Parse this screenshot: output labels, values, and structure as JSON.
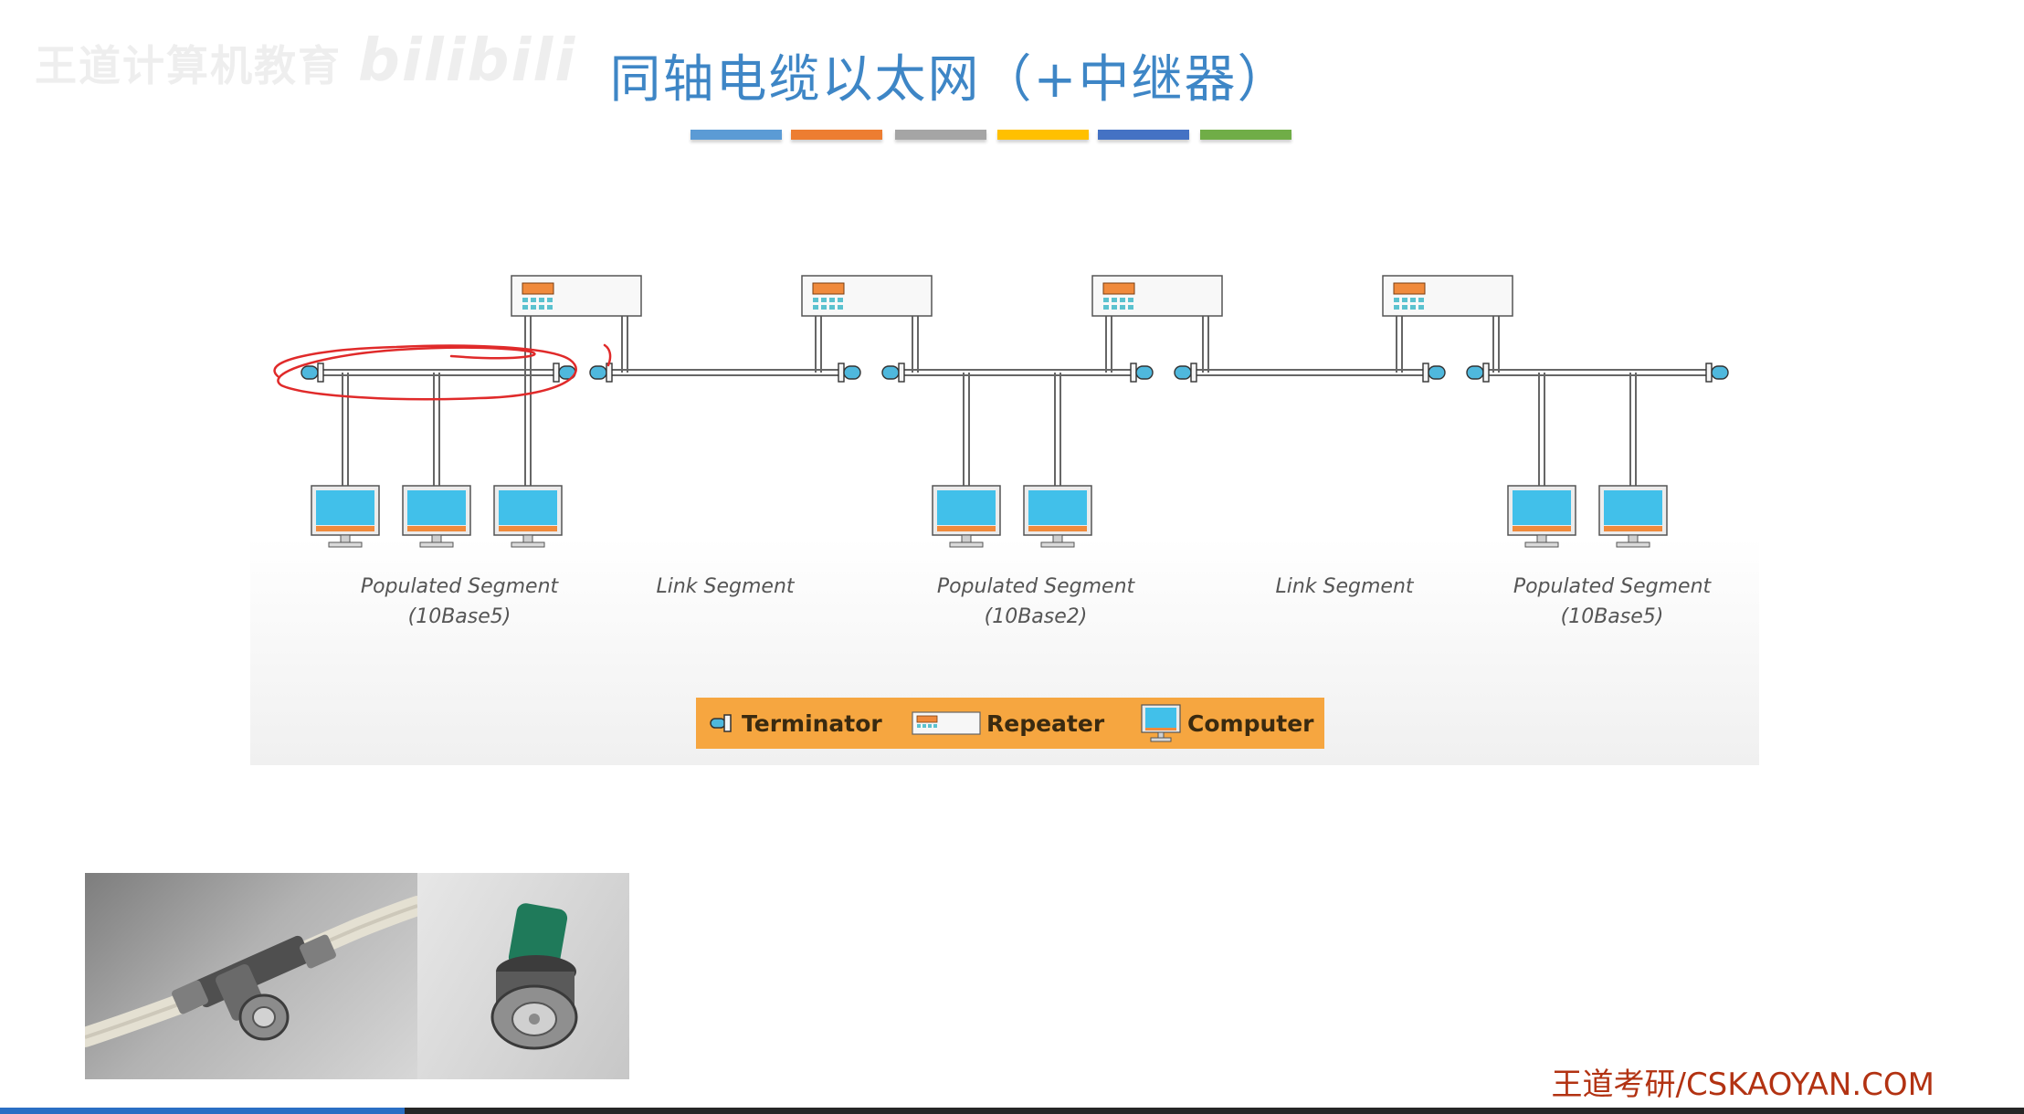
{
  "watermark": {
    "text": "王道计算机教育",
    "logo": "bilibili"
  },
  "title": "同轴电缆以太网（+中继器）",
  "divider_colors": [
    "#5b9bd5",
    "#ed7d31",
    "#a5a5a5",
    "#ffc000",
    "#4472c4",
    "#70ad47"
  ],
  "segments": [
    {
      "name": "Populated Segment",
      "spec": "(10Base5)"
    },
    {
      "name": "Link Segment",
      "spec": ""
    },
    {
      "name": "Populated Segment",
      "spec": "(10Base2)"
    },
    {
      "name": "Link Segment",
      "spec": ""
    },
    {
      "name": "Populated Segment",
      "spec": "(10Base5)"
    }
  ],
  "legend": {
    "terminator": "Terminator",
    "repeater": "Repeater",
    "computer": "Computer"
  },
  "colors": {
    "title": "#3e86c6",
    "screen": "#41c0ea",
    "repeater_display": "#f08a3c",
    "repeater_buttons": "#5bc2cf",
    "terminator": "#4fb8dd",
    "annotation": "#e02a2a",
    "legend_bg": "#f6a640",
    "footer": "#b23212",
    "progress": "#2a6fc4"
  },
  "progress": {
    "percent": 20
  },
  "footer": "王道考研/CSKAOYAN.COM"
}
